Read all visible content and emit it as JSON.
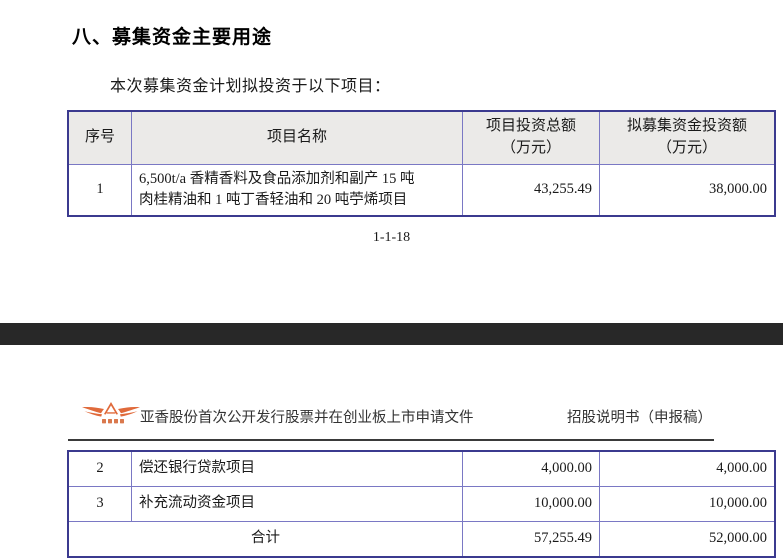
{
  "page_one": {
    "section_heading": "八、募集资金主要用途",
    "lead_paragraph": "本次募集资金计划拟投资于以下项目：",
    "page_number": "1-1-18",
    "table": {
      "headers": {
        "index": "序号",
        "name": "项目名称",
        "amount": "项目投资总额\n（万元）",
        "amount_line1": "项目投资总额",
        "amount_line2": "（万元）",
        "raise_line1": "拟募集资金投资额",
        "raise_line2": "（万元）"
      },
      "rows": [
        {
          "index": "1",
          "name_line1": "6,500t/a 香精香料及食品添加剂和副产 15 吨",
          "name_line2": "肉桂精油和 1 吨丁香轻油和 20 吨苧烯项目",
          "amount": "43,255.49",
          "raise": "38,000.00"
        }
      ]
    }
  },
  "page_two": {
    "running_header": {
      "logo_name": "yaxiang-logo",
      "title": "亚香股份首次公开发行股票并在创业板上市申请文件",
      "right_label": "招股说明书（申报稿）"
    },
    "table": {
      "rows": [
        {
          "index": "2",
          "name": "偿还银行贷款项目",
          "amount": "4,000.00",
          "raise": "4,000.00"
        },
        {
          "index": "3",
          "name": "补充流动资金项目",
          "amount": "10,000.00",
          "raise": "10,000.00"
        }
      ],
      "total": {
        "label": "合计",
        "amount": "57,255.49",
        "raise": "52,000.00"
      }
    }
  },
  "colors": {
    "table_border": "#7a78c4",
    "table_border_outer": "#3b3a8f",
    "header_fill": "#ebeae8",
    "page_gap": "#282828",
    "logo_orange": "#e06a3b"
  }
}
